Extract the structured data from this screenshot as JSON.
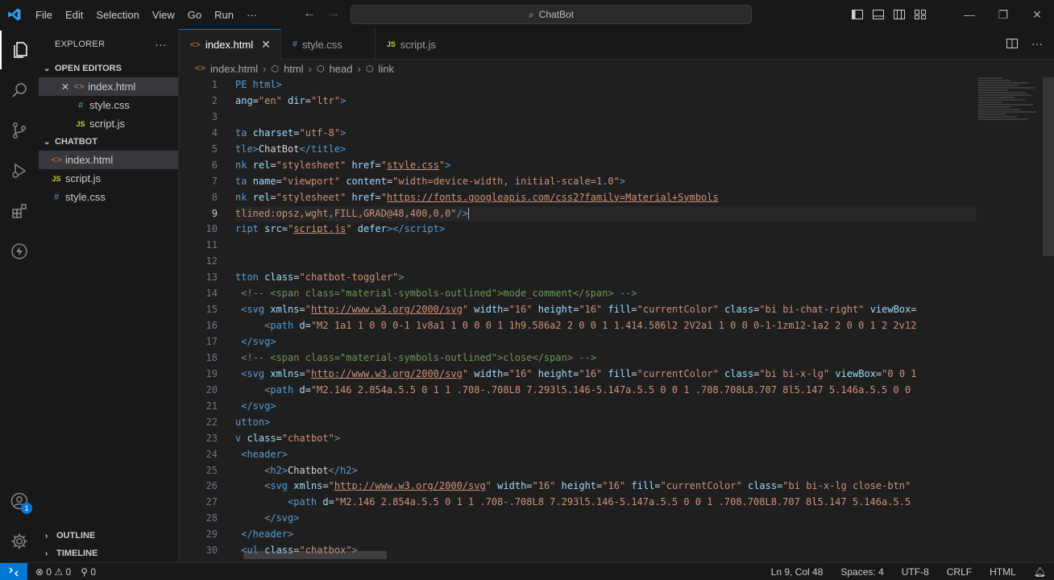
{
  "menu": [
    "File",
    "Edit",
    "Selection",
    "View",
    "Go",
    "Run",
    "···"
  ],
  "command_center": {
    "label": "ChatBot"
  },
  "window_controls": {
    "minimize": "—",
    "restore": "❐",
    "close": "✕"
  },
  "sidebar": {
    "title": "EXPLORER",
    "more": "···",
    "open_editors": {
      "title": "OPEN EDITORS",
      "items": [
        {
          "label": "index.html",
          "icon": "html-file-icon",
          "close": "✕"
        },
        {
          "label": "style.css",
          "icon": "css-file-icon"
        },
        {
          "label": "script.js",
          "icon": "js-file-icon"
        }
      ]
    },
    "project": {
      "title": "CHATBOT",
      "items": [
        {
          "label": "index.html",
          "icon": "html-file-icon"
        },
        {
          "label": "script.js",
          "icon": "js-file-icon"
        },
        {
          "label": "style.css",
          "icon": "css-file-icon"
        }
      ]
    },
    "outline": "OUTLINE",
    "timeline": "TIMELINE",
    "accounts_badge": "1"
  },
  "tabs": [
    {
      "label": "index.html",
      "icon": "html-file-icon",
      "active": true,
      "close": "✕"
    },
    {
      "label": "style.css",
      "icon": "css-file-icon"
    },
    {
      "label": "script.js",
      "icon": "js-file-icon"
    }
  ],
  "breadcrumb": [
    "index.html",
    "html",
    "head",
    "link"
  ],
  "editor": {
    "current_line": 9,
    "line_numbers": [
      "1",
      "2",
      "3",
      "4",
      "5",
      "6",
      "7",
      "8",
      "9",
      "10",
      "11",
      "12",
      "13",
      "14",
      "15",
      "16",
      "17",
      "18",
      "19",
      "20",
      "21",
      "22",
      "23",
      "24",
      "25",
      "26",
      "27",
      "28",
      "29",
      "30"
    ]
  },
  "status": {
    "errors": "0",
    "warnings": "0",
    "ports": "0",
    "position": "Ln 9, Col 48",
    "spaces": "Spaces: 4",
    "encoding": "UTF-8",
    "eol": "CRLF",
    "language": "HTML"
  },
  "colors": {
    "accent": "#0078d4",
    "tag": "#569cd6",
    "attribute": "#9cdcfe",
    "string": "#ce9178",
    "comment": "#6a9955"
  }
}
